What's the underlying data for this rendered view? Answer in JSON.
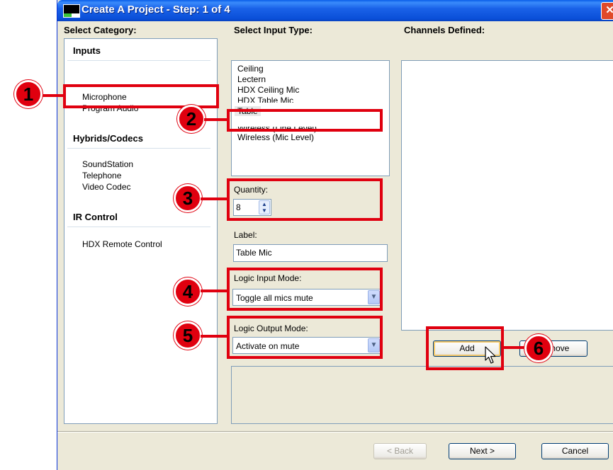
{
  "window": {
    "title": "Create A Project - Step: 1 of 4",
    "close_glyph": "✕"
  },
  "headers": {
    "category": "Select Category:",
    "input_type": "Select Input Type:",
    "channels": "Channels Defined:"
  },
  "categories": {
    "inputs_label": "Inputs",
    "inputs_items": [
      "Microphone",
      "Program Audio"
    ],
    "hybrids_label": "Hybrids/Codecs",
    "hybrids_items": [
      "SoundStation",
      "Telephone",
      "Video Codec"
    ],
    "ir_label": "IR Control",
    "ir_items": [
      "HDX Remote Control"
    ]
  },
  "input_types": {
    "items": [
      "Ceiling",
      "Lectern",
      "HDX Ceiling Mic",
      "HDX Table Mic",
      "Table",
      "Wireless (Line Level)",
      "Wireless (Mic Level)"
    ],
    "selected": "Table"
  },
  "quantity": {
    "label": "Quantity:",
    "value": "8"
  },
  "label_field": {
    "label": "Label:",
    "value": "Table Mic"
  },
  "logic_input": {
    "label": "Logic Input Mode:",
    "value": "Toggle all mics mute"
  },
  "logic_output": {
    "label": "Logic Output Mode:",
    "value": "Activate on mute"
  },
  "buttons": {
    "add": "Add",
    "remove": "Remove",
    "back": "< Back",
    "next": "Next >",
    "cancel": "Cancel"
  },
  "callouts": [
    "1",
    "2",
    "3",
    "4",
    "5",
    "6"
  ],
  "colors": {
    "callout_red": "#e0000f",
    "titlebar_blue": "#0a4fd8",
    "dialog_bg": "#ece9d8"
  },
  "icons": {
    "spin": "spin-updown-icon",
    "dropdown": "chevron-down-icon",
    "cursor": "hand-pointer-icon"
  }
}
